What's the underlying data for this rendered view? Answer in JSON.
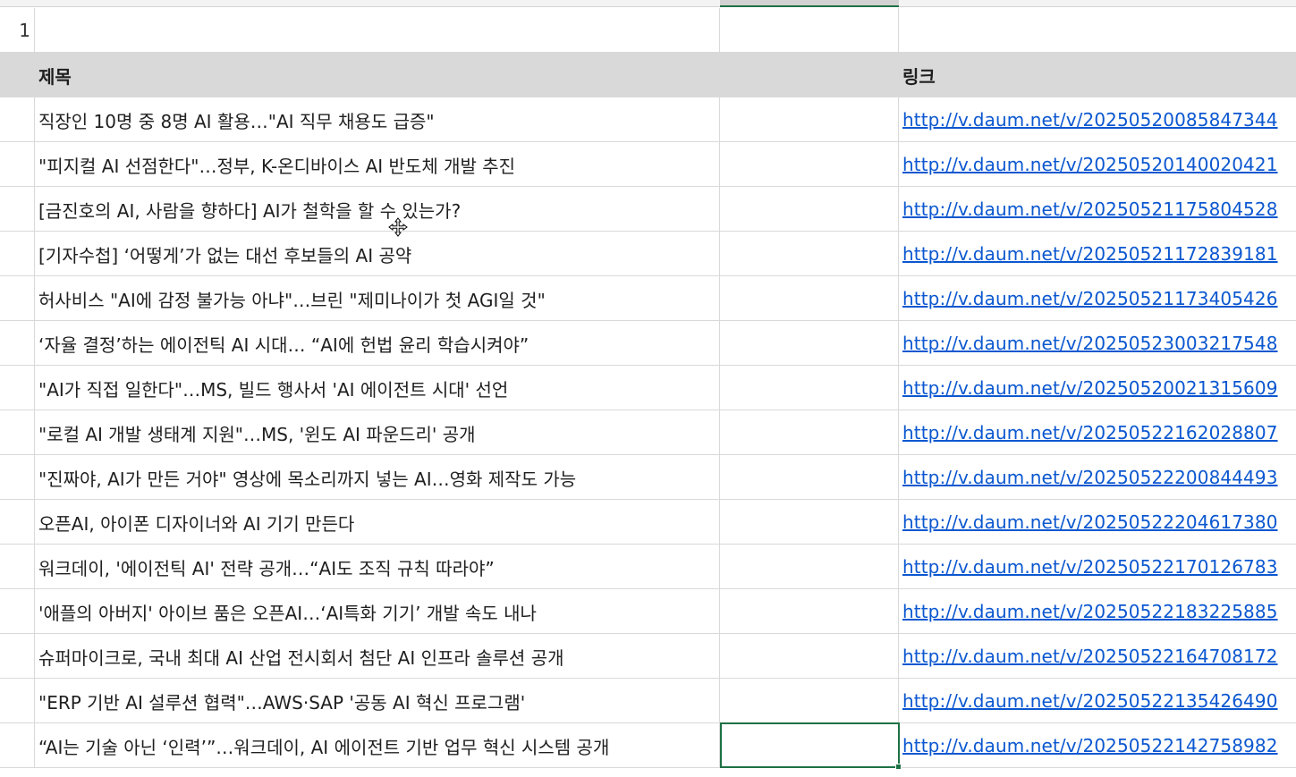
{
  "row_number": "1",
  "header": {
    "title_label": "제목",
    "link_label": "링크"
  },
  "rows": [
    {
      "title": "직장인 10명 중 8명 AI 활용…\"AI 직무 채용도 급증\"",
      "link": "http://v.daum.net/v/20250520085847344"
    },
    {
      "title": " \"피지컬 AI 선점한다\"…정부, K-온디바이스 AI 반도체 개발 추진",
      "link": "http://v.daum.net/v/20250520140020421"
    },
    {
      "title": " [금진호의 AI, 사람을 향하다] AI가 철학을 할 수 있는가?",
      "link": "http://v.daum.net/v/20250521175804528"
    },
    {
      "title": " [기자수첩] ‘어떻게’가 없는 대선 후보들의 AI 공약",
      "link": "http://v.daum.net/v/20250521172839181"
    },
    {
      "title": "허사비스 \"AI에 감정 불가능 아냐\"…브린 \"제미나이가 첫 AGI일 것\"",
      "link": "http://v.daum.net/v/20250521173405426"
    },
    {
      "title": "‘자율 결정’하는 에이전틱 AI 시대… “AI에 헌법 윤리 학습시켜야”",
      "link": "http://v.daum.net/v/20250523003217548"
    },
    {
      "title": " \"AI가 직접 일한다\"…MS, 빌드 행사서 'AI 에이전트 시대' 선언",
      "link": "http://v.daum.net/v/20250520021315609"
    },
    {
      "title": " \"로컬 AI 개발 생태계 지원\"…MS, '윈도 AI 파운드리' 공개",
      "link": "http://v.daum.net/v/20250522162028807"
    },
    {
      "title": "\"진짜야, AI가 만든 거야\" 영상에 목소리까지 넣는 AI…영화 제작도 가능",
      "link": "http://v.daum.net/v/20250522200844493"
    },
    {
      "title": "오픈AI, 아이폰 디자이너와 AI 기기 만든다",
      "link": "http://v.daum.net/v/20250522204617380"
    },
    {
      "title": "워크데이, '에이전틱 AI' 전략 공개…“AI도 조직 규칙 따라야”",
      "link": "http://v.daum.net/v/20250522170126783"
    },
    {
      "title": " '애플의 아버지' 아이브 품은 오픈AI…‘AI특화 기기’ 개발 속도 내나",
      "link": "http://v.daum.net/v/20250522183225885"
    },
    {
      "title": "슈퍼마이크로, 국내 최대 AI 산업 전시회서 첨단 AI 인프라 솔루션 공개",
      "link": "http://v.daum.net/v/20250522164708172"
    },
    {
      "title": " \"ERP 기반 AI 설루션 협력\"…AWS·SAP '공동 AI 혁신 프로그램'",
      "link": "http://v.daum.net/v/20250522135426490"
    },
    {
      "title": "“AI는 기술 아닌 ‘인력’”…워크데이, AI 에이전트 기반 업무 혁신 시스템 공개",
      "link": "http://v.daum.net/v/20250522142758982"
    }
  ],
  "colors": {
    "header_bg": "#d9d9d9",
    "grid_line": "#d9d9d9",
    "link": "#0b57d0",
    "selection": "#1e7145"
  },
  "icons": {
    "cursor": "move-cross-cursor-icon"
  }
}
